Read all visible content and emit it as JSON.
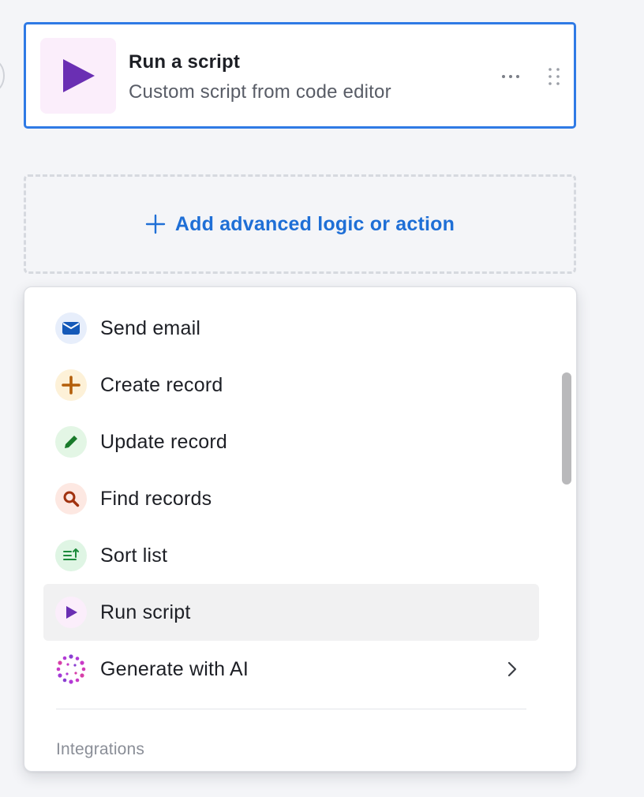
{
  "script_step": {
    "title": "Run a script",
    "subtitle": "Custom script from code editor",
    "icon": "play-icon",
    "accent_color": "#6a2fb3",
    "selected_border_color": "#2f7ae5"
  },
  "add_action": {
    "label": "Add advanced logic or action",
    "icon": "plus-icon",
    "color": "#1f6fd6"
  },
  "action_menu": {
    "items": [
      {
        "label": "Send email",
        "icon": "envelope-icon"
      },
      {
        "label": "Create record",
        "icon": "plus-icon"
      },
      {
        "label": "Update record",
        "icon": "pencil-icon"
      },
      {
        "label": "Find records",
        "icon": "magnifier-icon"
      },
      {
        "label": "Sort list",
        "icon": "sort-list-icon"
      },
      {
        "label": "Run script",
        "icon": "play-icon",
        "selected": true
      },
      {
        "label": "Generate with AI",
        "icon": "ai-sparkle-icon",
        "has_submenu": true
      }
    ],
    "section_label": "Integrations"
  }
}
